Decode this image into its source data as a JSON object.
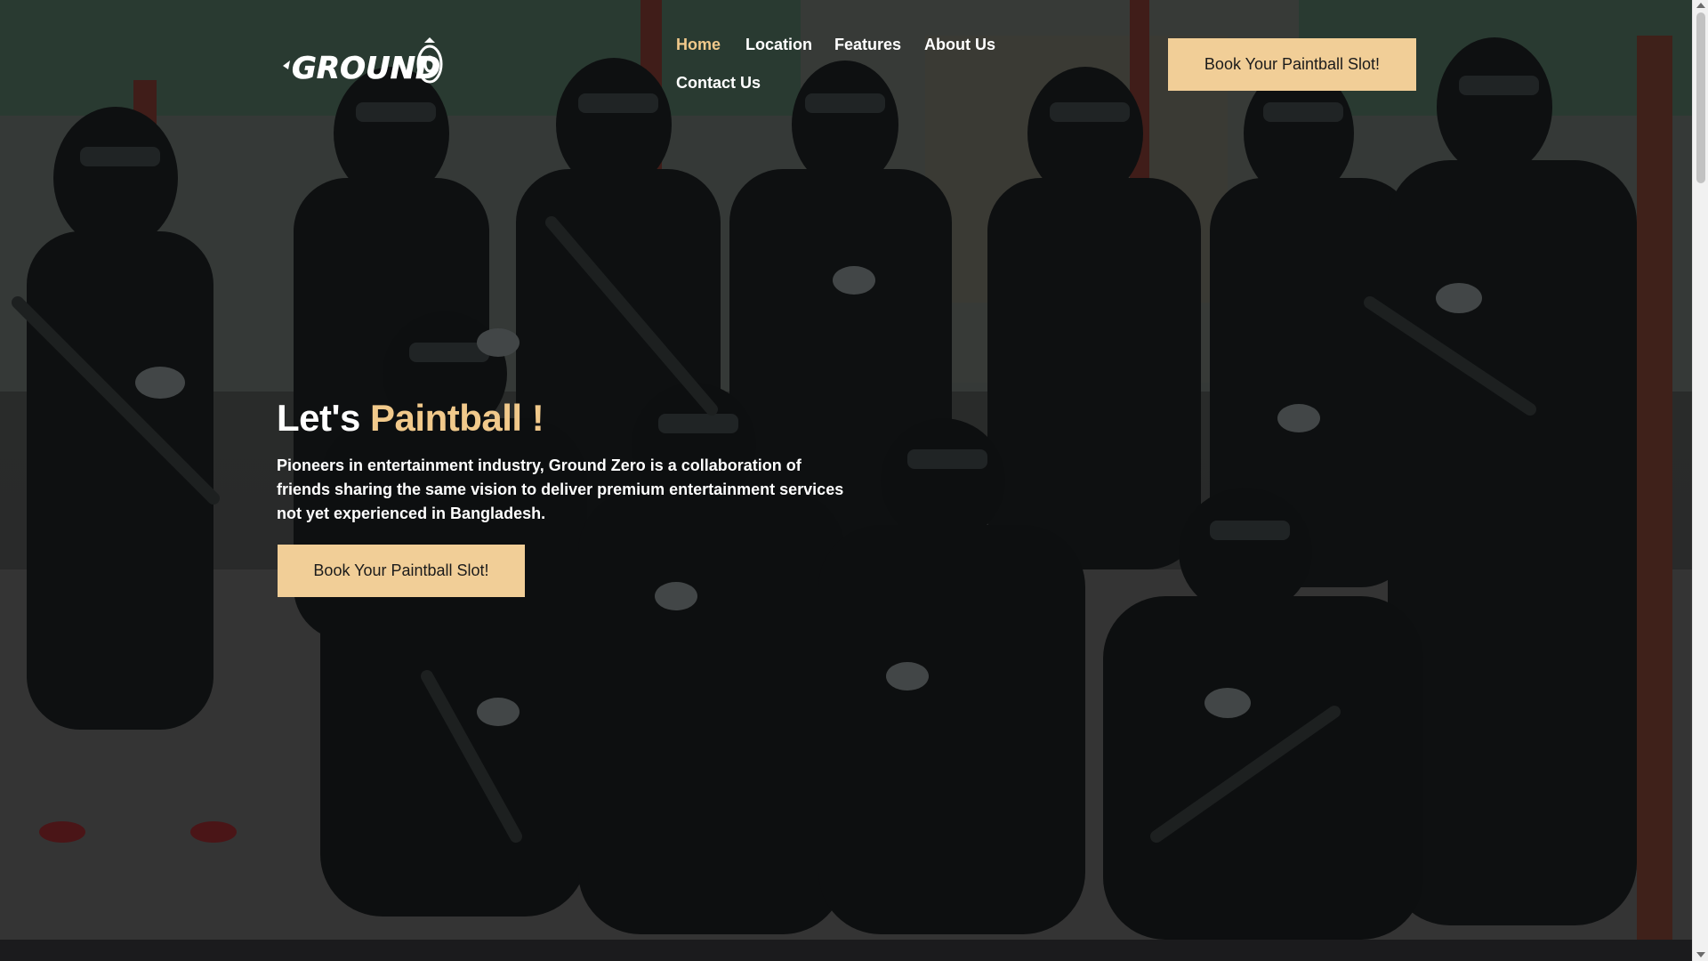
{
  "header": {
    "logo_text": "GROUND",
    "book_button": "Book Your Paintball Slot!"
  },
  "nav": {
    "items": [
      {
        "label": "Home",
        "active": true
      },
      {
        "label": "Location",
        "active": false
      },
      {
        "label": "Features",
        "active": false
      },
      {
        "label": "About Us",
        "active": false
      },
      {
        "label": "Contact Us",
        "active": false
      }
    ]
  },
  "hero": {
    "heading_plain": "Let's",
    "heading_accent": "Paintball !",
    "description": "Pioneers in entertainment industry, Ground Zero is a collaboration of friends sharing the same vision to deliver premium entertainment services not yet experienced in Bangladesh.",
    "book_button": "Book Your Paintball Slot!"
  },
  "colors": {
    "accent": "#f1c98b",
    "button_bg": "#f1ce97",
    "text": "#ffffff",
    "footer_strip": "#1b1b1d"
  },
  "icons": {
    "logo": "ground-zero-logo",
    "scroll_up": "chevron-up-icon",
    "scroll_down": "chevron-down-icon"
  }
}
